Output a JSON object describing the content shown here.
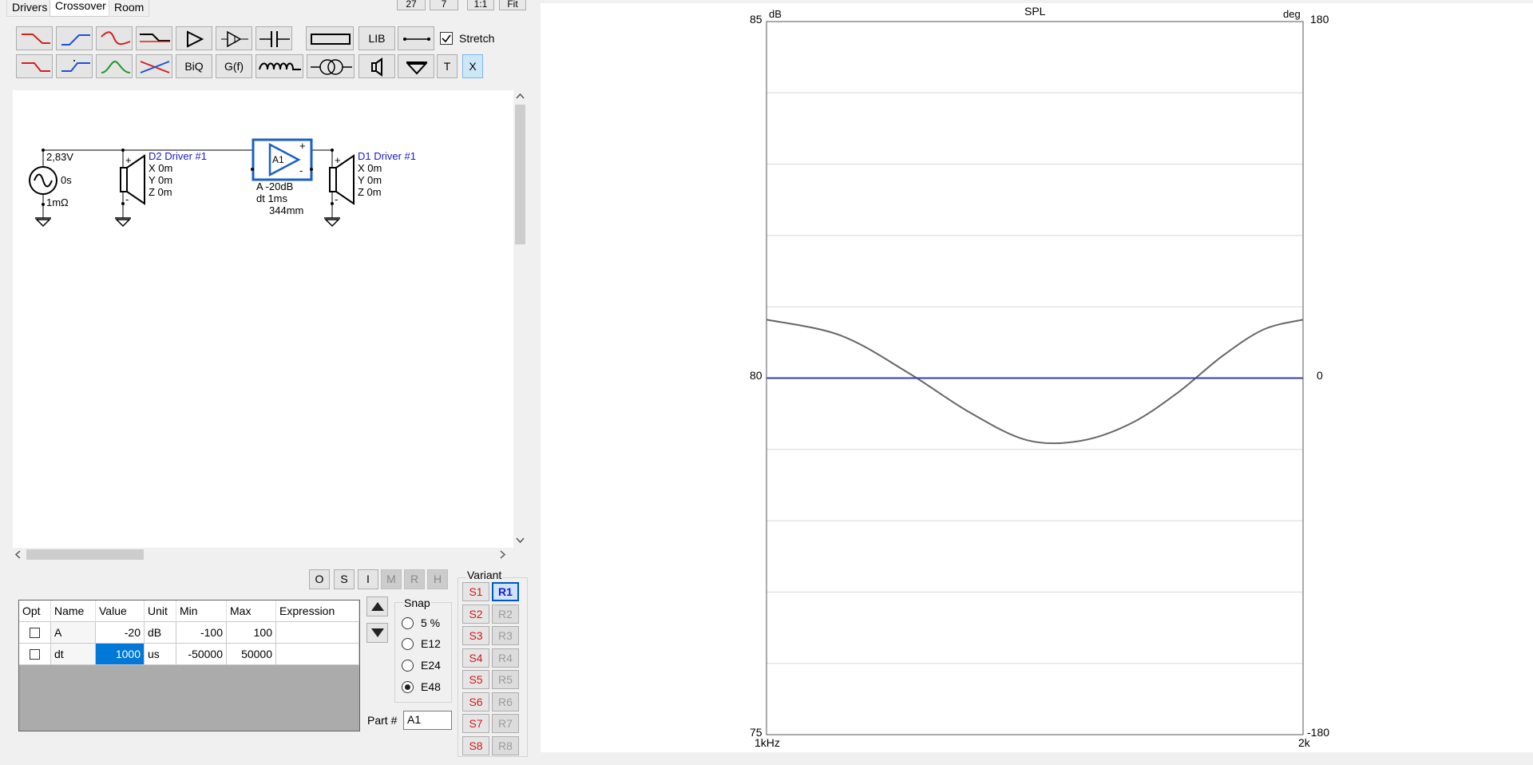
{
  "tabs": [
    "Drivers",
    "Crossover",
    "Room"
  ],
  "top_buttons": [
    "27",
    "7",
    "1:1",
    "Fit"
  ],
  "toolbar": {
    "row1": [
      "lowpass-red-icon",
      "highpass-blue-icon",
      "bandpass-red-icon",
      "shelf-icon",
      "amplifier-icon",
      "buffer-icon",
      "capacitor-icon",
      "resistor-icon",
      "LIB",
      "wire-icon"
    ],
    "row2": [
      "lowpass2-red-icon",
      "highpass2-blue-icon",
      "bandpass-green-icon",
      "notch-icon",
      "BiQ",
      "G(f)",
      "inductor-icon",
      "transformer-icon",
      "speaker-icon",
      "ground-icon",
      "T",
      "X"
    ],
    "lib_label": "LIB",
    "biq_label": "BiQ",
    "gf_label": "G(f)",
    "t_label": "T",
    "x_label": "X",
    "stretch_label": "Stretch",
    "stretch_checked": true
  },
  "schematic": {
    "source": {
      "voltage": "2,83V",
      "delay": "0s",
      "impedance": "1mΩ"
    },
    "driver2": {
      "name": "D2 Driver #1",
      "x": "X 0m",
      "y": "Y 0m",
      "z": "Z 0m"
    },
    "amp": {
      "label": "A1",
      "gain": "A  -20dB",
      "delay": "dt 1ms",
      "distance": "344mm"
    },
    "driver1": {
      "name": "D1 Driver #1",
      "x": "X 0m",
      "y": "Y 0m",
      "z": "Z 0m"
    }
  },
  "mode_buttons": [
    "O",
    "S",
    "I",
    "M",
    "R",
    "H"
  ],
  "param_grid": {
    "headers": [
      "Opt",
      "Name",
      "Value",
      "Unit",
      "Min",
      "Max",
      "Expression"
    ],
    "rows": [
      {
        "opt": false,
        "name": "A",
        "value": "-20",
        "unit": "dB",
        "min": "-100",
        "max": "100",
        "expression": ""
      },
      {
        "opt": false,
        "name": "dt",
        "value": "1000",
        "unit": "us",
        "min": "-50000",
        "max": "50000",
        "expression": ""
      }
    ]
  },
  "snap": {
    "title": "Snap",
    "options": [
      "5 %",
      "E12",
      "E24",
      "E48"
    ],
    "selected": "E48"
  },
  "part": {
    "label": "Part #",
    "value": "A1"
  },
  "variant": {
    "title": "Variant",
    "s_buttons": [
      "S1",
      "S2",
      "S3",
      "S4",
      "S5",
      "S6",
      "S7",
      "S8"
    ],
    "r_buttons": [
      "R1",
      "R2",
      "R3",
      "R4",
      "R5",
      "R6",
      "R7",
      "R8"
    ],
    "active": "R1"
  },
  "chart_data": {
    "type": "line",
    "title": "SPL",
    "ylabel_left": "dB",
    "ylabel_right": "deg",
    "ylim_left": [
      75,
      85
    ],
    "ylim_right": [
      -180,
      180
    ],
    "y_ticks_left": [
      "85",
      "80",
      "75"
    ],
    "y_ticks_right": [
      "180",
      "0",
      "-180"
    ],
    "x_ticks": [
      "1kHz",
      "2k"
    ],
    "xlim": [
      1000,
      2000
    ],
    "x_scale": "log",
    "grid": true,
    "series": [
      {
        "color": "#666666",
        "axis": "left",
        "x": [
          1000,
          1100,
          1200,
          1300,
          1400,
          1500,
          1600,
          1700,
          1800,
          1900,
          2000
        ],
        "y": [
          80.82,
          80.6,
          80.08,
          79.52,
          79.13,
          79.12,
          79.36,
          79.79,
          80.3,
          80.68,
          80.82
        ]
      },
      {
        "color": "#3b3bb8",
        "axis": "right",
        "x": [
          1000,
          2000
        ],
        "y": [
          0,
          0
        ]
      }
    ]
  }
}
